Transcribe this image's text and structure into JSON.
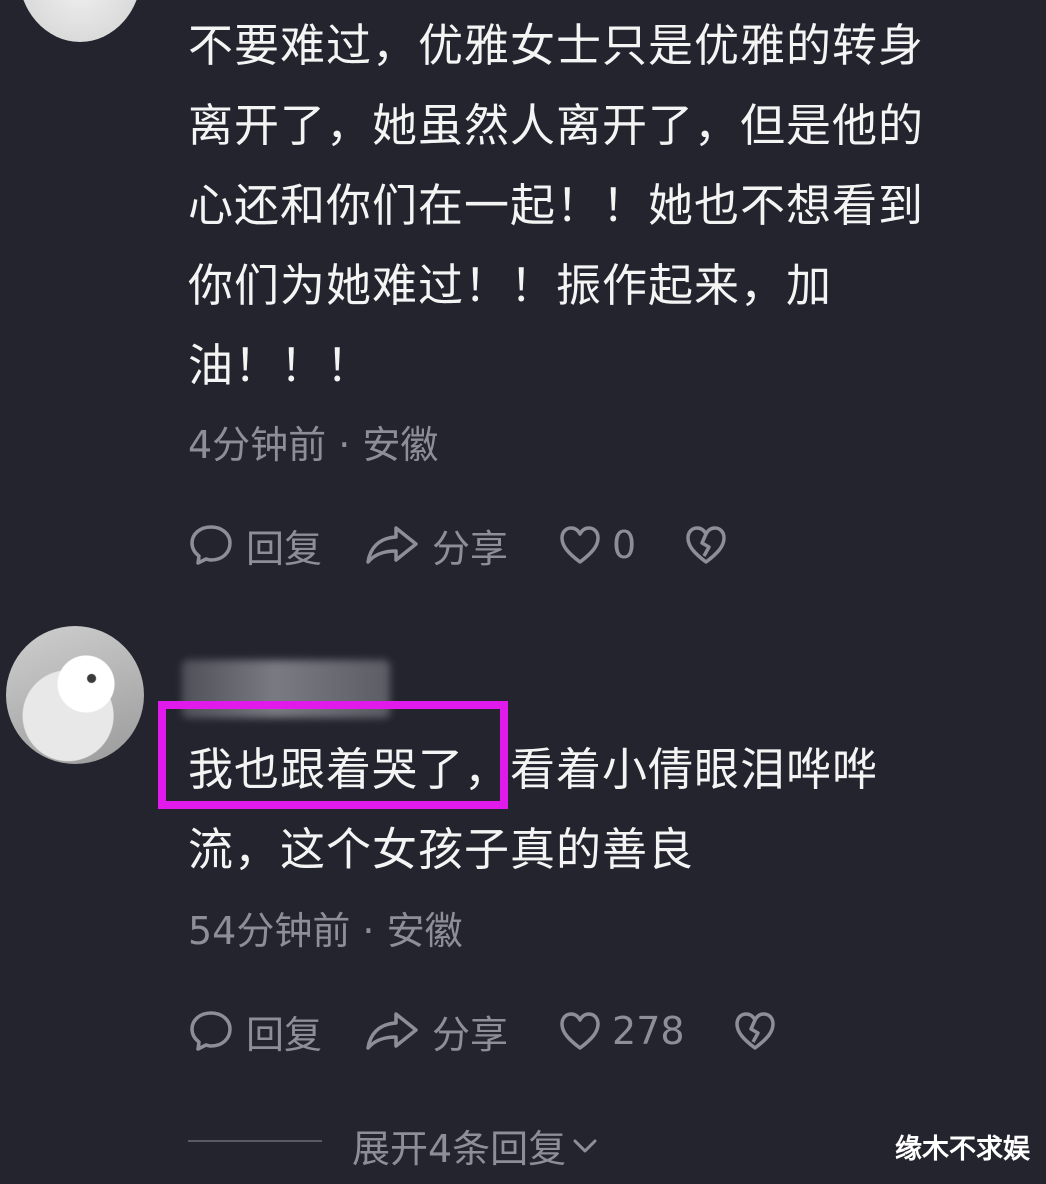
{
  "comments": [
    {
      "text_lines": [
        "不要难过，优雅女士只是优雅的转身",
        "离开了，她虽然人离开了，但是他的",
        "心还和你们在一起！！她也不想看到",
        "你们为她难过！！振作起来，加",
        "油！！！"
      ],
      "meta": "4分钟前 · 安徽",
      "reply_label": "回复",
      "share_label": "分享",
      "like_count": "0"
    },
    {
      "text_lines": [
        "我也跟着哭了，看着小倩眼泪哗哗",
        "流，这个女孩子真的善良"
      ],
      "meta": "54分钟前 · 安徽",
      "reply_label": "回复",
      "share_label": "分享",
      "like_count": "278"
    }
  ],
  "expand_replies": "展开4条回复",
  "watermark": "缘木不求娱",
  "colors": {
    "background": "#24242e",
    "text": "#f4f4f4",
    "muted": "#8e8e99",
    "highlight": "#e01aeb"
  },
  "icons": [
    "comment-bubble-icon",
    "share-arrow-icon",
    "heart-icon",
    "broken-heart-icon",
    "chevron-down-icon"
  ]
}
